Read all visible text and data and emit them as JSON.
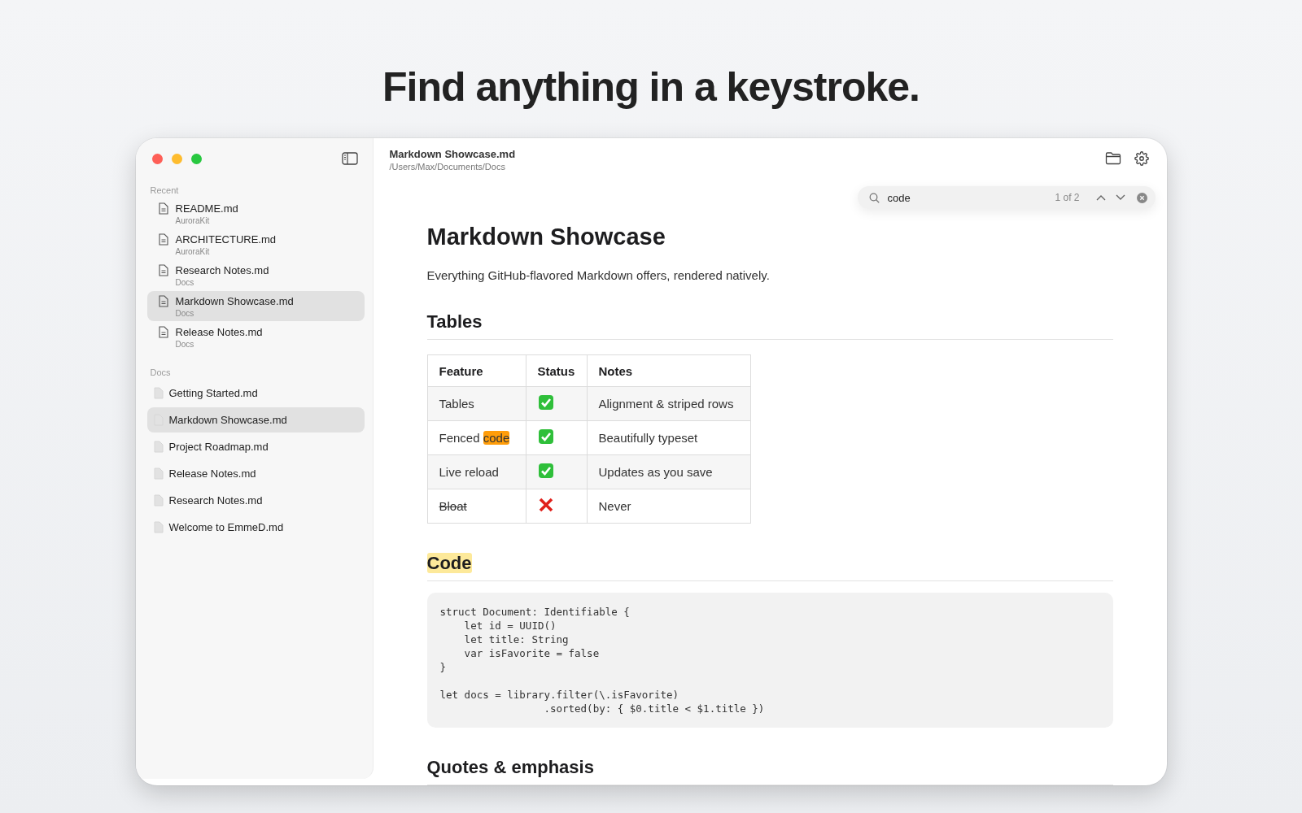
{
  "headline": "Find anything in a keystroke.",
  "window": {
    "controls": [
      {
        "kind": "close"
      },
      {
        "kind": "minimize"
      },
      {
        "kind": "zoom"
      }
    ]
  },
  "sidebar": {
    "sections": [
      {
        "kind": "recent",
        "label": "Recent",
        "items": [
          {
            "title": "README.md",
            "subtitle": "AuroraKit",
            "selected": false
          },
          {
            "title": "ARCHITECTURE.md",
            "subtitle": "AuroraKit",
            "selected": false
          },
          {
            "title": "Research Notes.md",
            "subtitle": "Docs",
            "selected": false
          },
          {
            "title": "Markdown Showcase.md",
            "subtitle": "Docs",
            "selected": true
          },
          {
            "title": "Release Notes.md",
            "subtitle": "Docs",
            "selected": false
          }
        ]
      },
      {
        "kind": "folder",
        "label": "Docs",
        "items": [
          {
            "title": "Getting Started.md",
            "selected": false
          },
          {
            "title": "Markdown Showcase.md",
            "selected": true
          },
          {
            "title": "Project Roadmap.md",
            "selected": false
          },
          {
            "title": "Release Notes.md",
            "selected": false
          },
          {
            "title": "Research Notes.md",
            "selected": false
          },
          {
            "title": "Welcome to EmmeD.md",
            "selected": false
          }
        ]
      }
    ]
  },
  "header": {
    "title": "Markdown Showcase.md",
    "path": "/Users/Max/Documents/Docs"
  },
  "search": {
    "value": "code",
    "count": "1 of 2"
  },
  "document": [
    {
      "kind": "h1",
      "text": "Markdown Showcase"
    },
    {
      "kind": "p",
      "text": "Everything GitHub-flavored Markdown offers, rendered natively."
    },
    {
      "kind": "h2",
      "text": "Tables",
      "match": false
    },
    {
      "kind": "table",
      "columns": [
        "Feature",
        "Status",
        "Notes"
      ],
      "rows": [
        {
          "feature": [
            {
              "text": "Tables",
              "match": false
            }
          ],
          "strikethrough": false,
          "done": true,
          "notes": "Alignment & striped rows"
        },
        {
          "feature": [
            {
              "text": "Fenced",
              "match": false
            },
            {
              "text": "code",
              "match": true,
              "current": true
            }
          ],
          "strikethrough": false,
          "done": true,
          "notes": "Beautifully typeset"
        },
        {
          "feature": [
            {
              "text": "Live reload",
              "match": false
            }
          ],
          "strikethrough": false,
          "done": true,
          "notes": "Updates as you save"
        },
        {
          "feature": [
            {
              "text": "Bloat",
              "match": false
            }
          ],
          "strikethrough": true,
          "done": false,
          "notes": "Never"
        }
      ]
    },
    {
      "kind": "h2",
      "text": "Code",
      "match": true
    },
    {
      "kind": "code",
      "groups": [
        [
          "struct Document: Identifiable {",
          "    let id = UUID()",
          "    let title: String",
          "    var isFavorite = false",
          "}"
        ],
        [
          "let docs = library.filter(\\.isFavorite)",
          "                 .sorted(by: { $0.title < $1.title })"
        ]
      ]
    },
    {
      "kind": "h2",
      "text": "Quotes & emphasis",
      "match": false
    }
  ]
}
